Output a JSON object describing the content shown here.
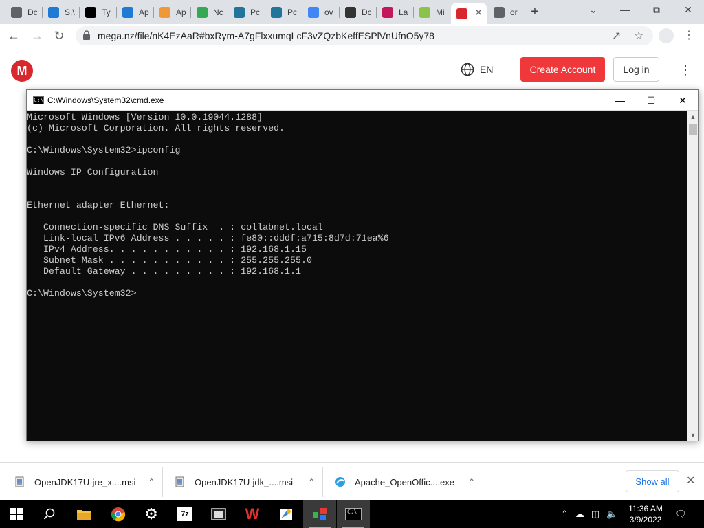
{
  "browser": {
    "tabs": [
      {
        "label": "Dc",
        "icon": "chrome-icon",
        "color": "#5f6368"
      },
      {
        "label": "S.\\",
        "icon": "edge-icon",
        "color": "#1f7ad6"
      },
      {
        "label": "Ty",
        "icon": "typora-icon",
        "color": "#000000"
      },
      {
        "label": "Ap",
        "icon": "edge-icon",
        "color": "#1f7ad6"
      },
      {
        "label": "Ap",
        "icon": "git-icon",
        "color": "#f09737"
      },
      {
        "label": "Nc",
        "icon": "play-icon",
        "color": "#34a853"
      },
      {
        "label": "Pc",
        "icon": "wordpress-icon",
        "color": "#21759b"
      },
      {
        "label": "Pc",
        "icon": "wordpress-icon",
        "color": "#21759b"
      },
      {
        "label": "ov",
        "icon": "google-icon",
        "color": "#4285f4"
      },
      {
        "label": "Dc",
        "icon": "monitor-icon",
        "color": "#333333"
      },
      {
        "label": "La",
        "icon": "launchpad-icon",
        "color": "#c2185b"
      },
      {
        "label": "Mi",
        "icon": "kite-icon",
        "color": "#8bc34a"
      },
      {
        "label": "",
        "icon": "mega-icon",
        "color": "#d9272e",
        "active": true
      },
      {
        "label": "or",
        "icon": "chrome-icon",
        "color": "#5f6368"
      }
    ],
    "new_tab": "+",
    "url": "mega.nz/file/nK4EzAaR#bxRym-A7gFlxxumqLcF3vZQzbKeffESPlVnUfnO5y78"
  },
  "mega": {
    "logo": "M",
    "language": "EN",
    "create_account": "Create Account",
    "login": "Log in"
  },
  "cmd": {
    "title": "C:\\Windows\\System32\\cmd.exe",
    "lines": [
      "Microsoft Windows [Version 10.0.19044.1288]",
      "(c) Microsoft Corporation. All rights reserved.",
      "",
      "C:\\Windows\\System32>ipconfig",
      "",
      "Windows IP Configuration",
      "",
      "",
      "Ethernet adapter Ethernet:",
      "",
      "   Connection-specific DNS Suffix  . : collabnet.local",
      "   Link-local IPv6 Address . . . . . : fe80::dddf:a715:8d7d:71ea%6",
      "   IPv4 Address. . . . . . . . . . . : 192.168.1.15",
      "   Subnet Mask . . . . . . . . . . . : 255.255.255.0",
      "   Default Gateway . . . . . . . . . : 192.168.1.1",
      "",
      "C:\\Windows\\System32>"
    ]
  },
  "downloads": {
    "items": [
      {
        "name": "OpenJDK17U-jre_x....msi"
      },
      {
        "name": "OpenJDK17U-jdk_....msi"
      },
      {
        "name": "Apache_OpenOffic....exe"
      }
    ],
    "show_all": "Show all"
  },
  "taskbar": {
    "time": "11:36 AM",
    "date": "3/9/2022"
  }
}
